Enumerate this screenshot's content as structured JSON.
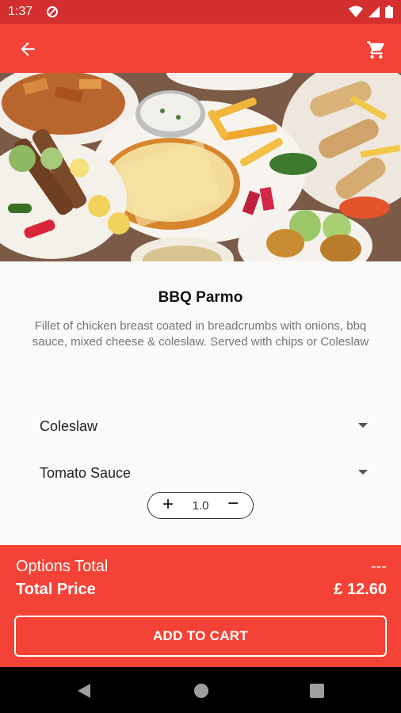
{
  "status_bar": {
    "time": "1:37"
  },
  "product": {
    "name": "BBQ Parmo",
    "description": "Fillet of chicken breast coated in breadcrumbs with onions, bbq sauce, mixed cheese & coleslaw. Served with chips or Coleslaw"
  },
  "options": [
    {
      "selected": "Coleslaw"
    },
    {
      "selected": "Tomato Sauce"
    }
  ],
  "quantity": {
    "plus_label": "+",
    "value": "1.0",
    "minus_label": "−"
  },
  "totals": {
    "options_total_label": "Options Total",
    "options_total_value": "---",
    "total_price_label": "Total Price",
    "total_price_value": "£ 12.60"
  },
  "actions": {
    "add_to_cart_label": "ADD TO CART"
  },
  "colors": {
    "primary": "#f44336",
    "primary_dark": "#d32f2f",
    "background": "#fafafa"
  },
  "icons": {
    "back": "arrow-back-icon",
    "cart": "shopping-cart-icon",
    "nav_back": "triangle-back-icon",
    "nav_home": "circle-home-icon",
    "nav_recents": "square-recents-icon"
  }
}
